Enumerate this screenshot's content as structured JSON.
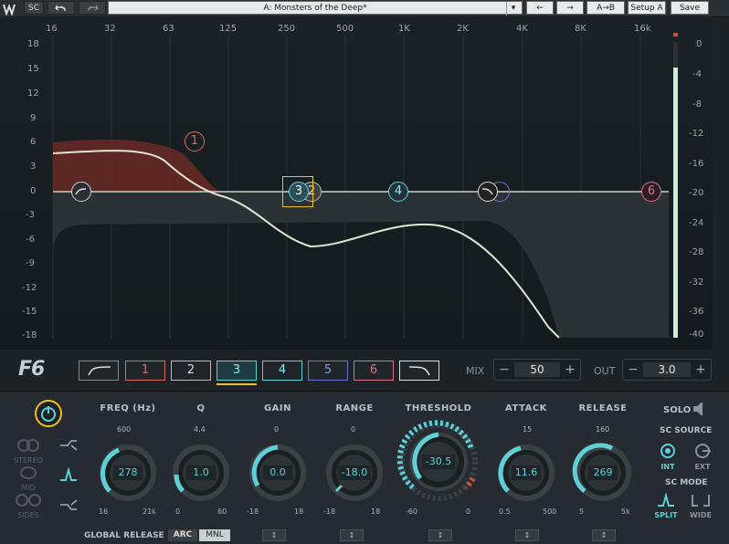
{
  "topbar": {
    "sc_label": "SC",
    "undo_icon": "undo-icon",
    "redo_icon": "redo-icon",
    "preset_name": "A: Monsters of the Deep*",
    "prev_icon": "arrow-left-icon",
    "next_icon": "arrow-right-icon",
    "ab_label": "A→B",
    "setup_label": "Setup A",
    "save_label": "Save"
  },
  "graph": {
    "freq_labels": [
      "16",
      "32",
      "63",
      "125",
      "250",
      "500",
      "1K",
      "2K",
      "4K",
      "8K",
      "16k"
    ],
    "db_labels": [
      "18",
      "15",
      "12",
      "9",
      "6",
      "3",
      "0",
      "-3",
      "-6",
      "-9",
      "-12",
      "-15",
      "-18"
    ],
    "meter_labels": [
      "0",
      "-4",
      "-8",
      "-12",
      "-16",
      "-20",
      "-24",
      "-28",
      "-32",
      "-36",
      "-40"
    ],
    "nodes": {
      "n1": "1",
      "n2": "2",
      "n3": "3",
      "n4": "4",
      "n6": "6"
    }
  },
  "logo": "F6",
  "band_buttons": {
    "b1": "1",
    "b2": "2",
    "b3": "3",
    "b4": "4",
    "b5": "5",
    "b6": "6"
  },
  "mix": {
    "label": "MIX",
    "value": "50",
    "minus": "−",
    "plus": "+"
  },
  "out": {
    "label": "OUT",
    "value": "3.0",
    "minus": "−",
    "plus": "+"
  },
  "knobs": {
    "freq": {
      "label": "FREQ (Hz)",
      "value": "278",
      "top": "600",
      "min": "16",
      "max": "21k"
    },
    "q": {
      "label": "Q",
      "value": "1.0",
      "top": "4.4",
      "min": "0",
      "max": "60"
    },
    "gain": {
      "label": "GAIN",
      "value": "0.0",
      "top": "0",
      "min": "-18",
      "max": "18"
    },
    "range": {
      "label": "RANGE",
      "value": "-18.0",
      "top": "0",
      "min": "-18",
      "max": "18"
    },
    "threshold": {
      "label": "THRESHOLD",
      "value": "-30.5",
      "min": "-60",
      "max": "0"
    },
    "attack": {
      "label": "ATTACK",
      "value": "11.6",
      "top": "15",
      "min": "0.5",
      "max": "500"
    },
    "release": {
      "label": "RELEASE",
      "value": "269",
      "top": "160",
      "min": "5",
      "max": "5k"
    }
  },
  "left_panel": {
    "stereo": "STEREO",
    "mid": "MID",
    "sides": "SIDES"
  },
  "solo": "SOLO",
  "sc_source": {
    "label": "SC SOURCE",
    "int": "INT",
    "ext": "EXT"
  },
  "sc_mode": {
    "label": "SC MODE",
    "split": "SPLIT",
    "wide": "WIDE"
  },
  "global_release": {
    "label": "GLOBAL RELEASE",
    "arc": "ARC",
    "mnl": "MNL",
    "arrows": "↕"
  },
  "colors": {
    "accent": "#5fd0d8",
    "band1": "#e06a5a",
    "band5": "#6a74d8",
    "band6": "#e0708a",
    "power": "#f0c020"
  }
}
